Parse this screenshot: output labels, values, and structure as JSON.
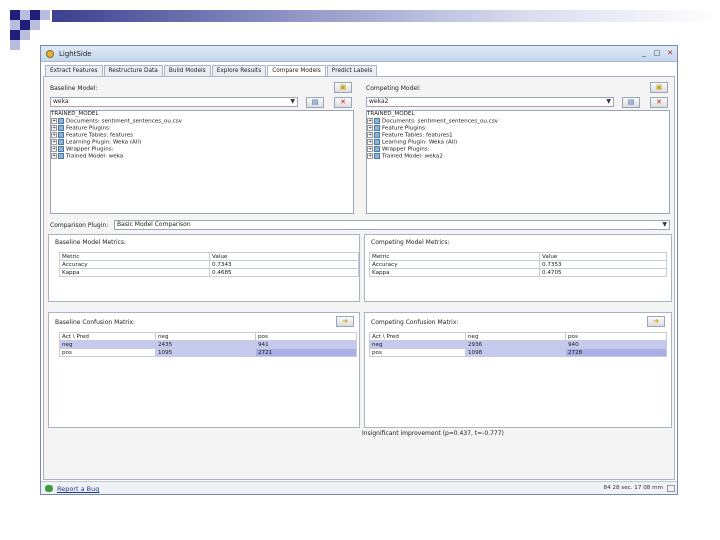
{
  "window": {
    "title": "LightSide",
    "minimize": "_",
    "maximize": "□",
    "close": "✕"
  },
  "tabs": [
    "Extract Features",
    "Restructure Data",
    "Build Models",
    "Explore Results",
    "Compare Models",
    "Predict Labels"
  ],
  "active_tab": "Compare Models",
  "baseline": {
    "label": "Baseline Model:",
    "selected": "weka",
    "tree": [
      "TRAINED_MODEL",
      "Documents: sentiment_sentences_ou.csv",
      "Feature Plugins:",
      "Feature Tables: features",
      "Learning Plugin: Weka (All)",
      "Wrapper Plugins:",
      "Trained Model: weka"
    ]
  },
  "competing": {
    "label": "Competing Model:",
    "selected": "weka2",
    "tree": [
      "TRAINED_MODEL",
      "Documents: sentiment_sentences_ou.csv",
      "Feature Plugins:",
      "Feature Tables: features1",
      "Learning Plugin: Weka (All)",
      "Wrapper Plugins:",
      "Trained Model: weka2"
    ]
  },
  "comparison": {
    "label": "Comparison Plugin:",
    "selected": "Basic Model Comparison"
  },
  "baseline_metrics": {
    "title": "Baseline Model Metrics:",
    "headers": [
      "Metric",
      "Value"
    ],
    "rows": [
      [
        "Accuracy",
        "0.7343"
      ],
      [
        "Kappa",
        "0.4685"
      ]
    ]
  },
  "competing_metrics": {
    "title": "Competing Model Metrics:",
    "headers": [
      "Metric",
      "Value"
    ],
    "rows": [
      [
        "Accuracy",
        "0.7353"
      ],
      [
        "Kappa",
        "0.4705"
      ]
    ]
  },
  "baseline_confusion": {
    "title": "Baseline Confusion Matrix:",
    "headers": [
      "Act \\ Pred",
      "neg",
      "pos"
    ],
    "rows": [
      [
        "neg",
        "2435",
        "941"
      ],
      [
        "pos",
        "1095",
        "2721"
      ]
    ]
  },
  "competing_confusion": {
    "title": "Competing Confusion Matrix:",
    "headers": [
      "Act \\ Pred",
      "neg",
      "pos"
    ],
    "rows": [
      [
        "neg",
        "2936",
        "940"
      ],
      [
        "pos",
        "1098",
        "2728"
      ]
    ]
  },
  "significance": "Insignificant improvement (p=0.437, t=-0.777)",
  "status": {
    "report_bug": "Report a Bug",
    "right": "84 28 sec. 17 08 mm"
  },
  "colors": {
    "accent_dark": "#1f1f7a",
    "accent_light": "#b9bedf",
    "highlight": "#a8aee8"
  },
  "icons": {
    "open": "folder-open-icon",
    "save": "save-icon",
    "delete": "delete-icon",
    "go": "arrow-right-icon"
  }
}
